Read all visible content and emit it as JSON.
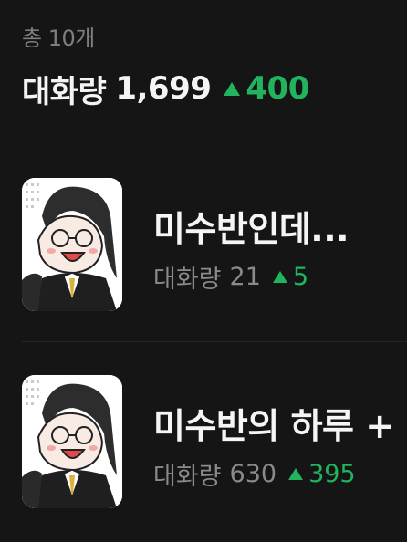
{
  "header": {
    "total_label": "총 10개",
    "summary_label": "대화량",
    "summary_value": "1,699",
    "summary_delta": "400"
  },
  "colors": {
    "background": "#151515",
    "positive": "#22b35e",
    "muted": "#8a8a8a"
  },
  "chats": [
    {
      "title": "미수반인데...",
      "stat_label": "대화량",
      "count": "21",
      "delta": "5",
      "trend_icon": "up-triangle-icon"
    },
    {
      "title": "미수반의 하루 +",
      "stat_label": "대화량",
      "count": "630",
      "delta": "395",
      "trend_icon": "up-triangle-icon"
    }
  ]
}
